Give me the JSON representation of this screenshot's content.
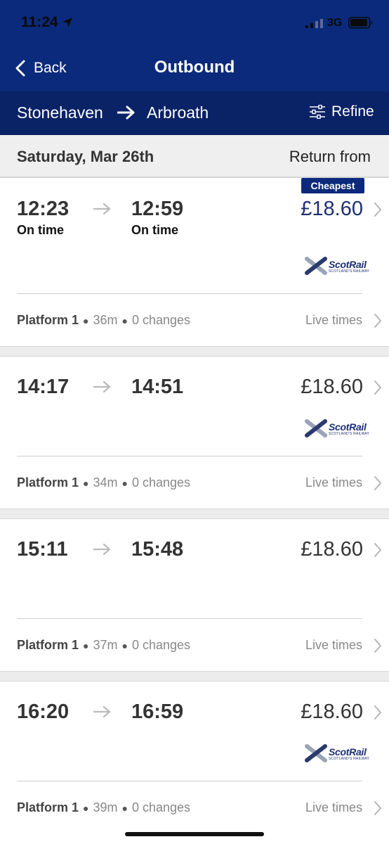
{
  "status_bar": {
    "time": "11:24",
    "network": "3G",
    "icons": [
      "location-arrow-icon",
      "signal-bars-icon",
      "battery-icon"
    ]
  },
  "nav": {
    "back_label": "Back",
    "title": "Outbound"
  },
  "route": {
    "from": "Stonehaven",
    "to": "Arbroath",
    "refine_label": "Refine"
  },
  "date_bar": {
    "date": "Saturday, Mar 26th",
    "return_label": "Return from"
  },
  "journeys": [
    {
      "departure": "12:23",
      "arrival": "12:59",
      "departure_status": "On time",
      "arrival_status": "On time",
      "price": "£18.60",
      "badge": "Cheapest",
      "operator_logo": "ScotRail",
      "platform": "Platform 1",
      "duration": "36m",
      "changes": "0 changes",
      "live_label": "Live times"
    },
    {
      "departure": "14:17",
      "arrival": "14:51",
      "price": "£18.60",
      "operator_logo": "ScotRail",
      "platform": "Platform 1",
      "duration": "34m",
      "changes": "0 changes",
      "live_label": "Live times"
    },
    {
      "departure": "15:11",
      "arrival": "15:48",
      "price": "£18.60",
      "platform": "Platform 1",
      "duration": "37m",
      "changes": "0 changes",
      "live_label": "Live times"
    },
    {
      "departure": "16:20",
      "arrival": "16:59",
      "price": "£18.60",
      "operator_logo": "ScotRail",
      "platform": "Platform 1",
      "duration": "39m",
      "changes": "0 changes",
      "live_label": "Live times"
    }
  ],
  "logo": {
    "name": "ScotRail",
    "tagline": "SCOTLAND'S RAILWAY"
  },
  "colors": {
    "header_navy": "#0b2a7b",
    "route_bar_navy": "#0a2266",
    "cheapest_price": "#1c2f72",
    "background": "#ececec"
  }
}
